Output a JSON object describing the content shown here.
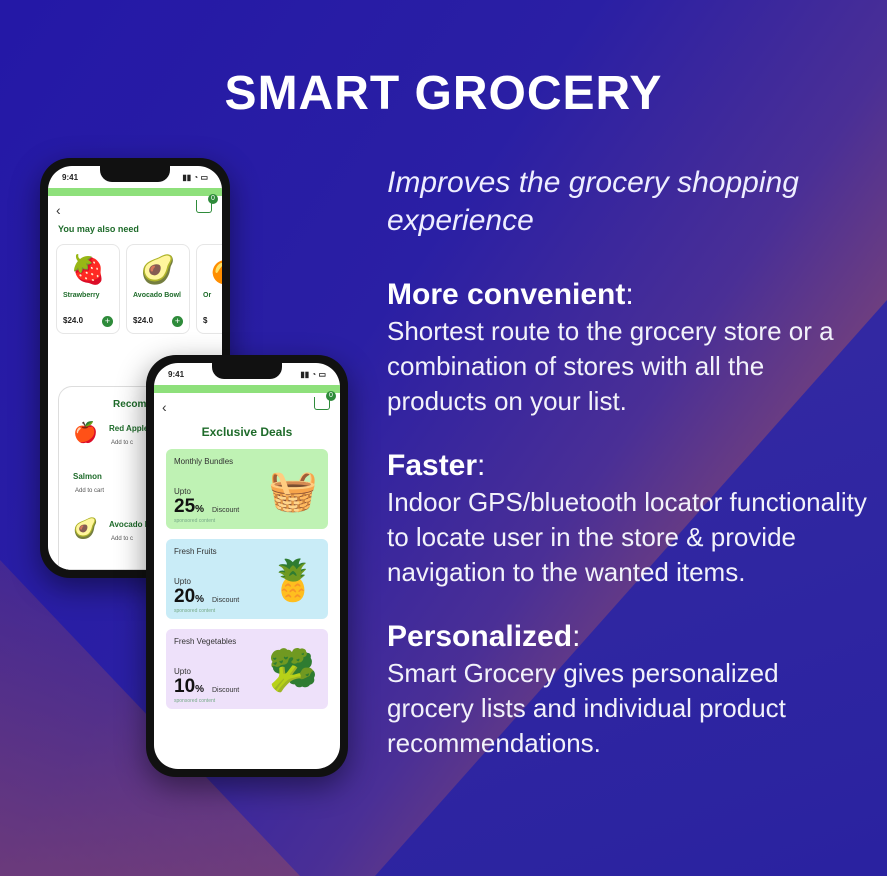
{
  "title": "SMART GROCERY",
  "tagline": "Improves the grocery shopping experience",
  "features": [
    {
      "heading": "More convenient",
      "body": "Shortest route to the grocery store or a combination of stores with all the products on your list."
    },
    {
      "heading": "Faster",
      "body": "Indoor GPS/bluetooth locator functionality to locate user in the store & provide navigation to the wanted items."
    },
    {
      "heading": "Personalized",
      "body": "Smart Grocery gives personalized grocery lists and individual product recommendations."
    }
  ],
  "phone1": {
    "time": "9:41",
    "cart_count": "0",
    "section_title": "You may also need",
    "products": [
      {
        "name": "Strawberry",
        "price": "$24.0",
        "icon": "strawberry-icon"
      },
      {
        "name": "Avocado Bowl",
        "price": "$24.0",
        "icon": "avocado-icon"
      },
      {
        "name": "Or",
        "price": "$",
        "icon": "orange-icon"
      }
    ],
    "recommend_title": "Recommen",
    "recommended": [
      {
        "name": "Red Apple",
        "action": "Add to c",
        "icon": "apple-icon"
      },
      {
        "name": "Salmon",
        "action": "Add to cart",
        "icon": ""
      },
      {
        "name": "Avocado B",
        "action": "Add to c",
        "icon": "avocado-icon"
      }
    ]
  },
  "phone2": {
    "time": "9:41",
    "cart_count": "0",
    "title": "Exclusive Deals",
    "deals": [
      {
        "category": "Monthly Bundles",
        "upto": "Upto",
        "percent": "25",
        "discount": "Discount",
        "terms": "sponsored content",
        "icon": "basket-icon",
        "color": "#bff2b4"
      },
      {
        "category": "Fresh Fruits",
        "upto": "Upto",
        "percent": "20",
        "discount": "Discount",
        "terms": "sponsored content",
        "icon": "fruits-icon",
        "color": "#c9ecf7"
      },
      {
        "category": "Fresh Vegetables",
        "upto": "Upto",
        "percent": "10",
        "discount": "Discount",
        "terms": "sponsored content",
        "icon": "broccoli-icon",
        "color": "#eee1fa"
      }
    ]
  }
}
